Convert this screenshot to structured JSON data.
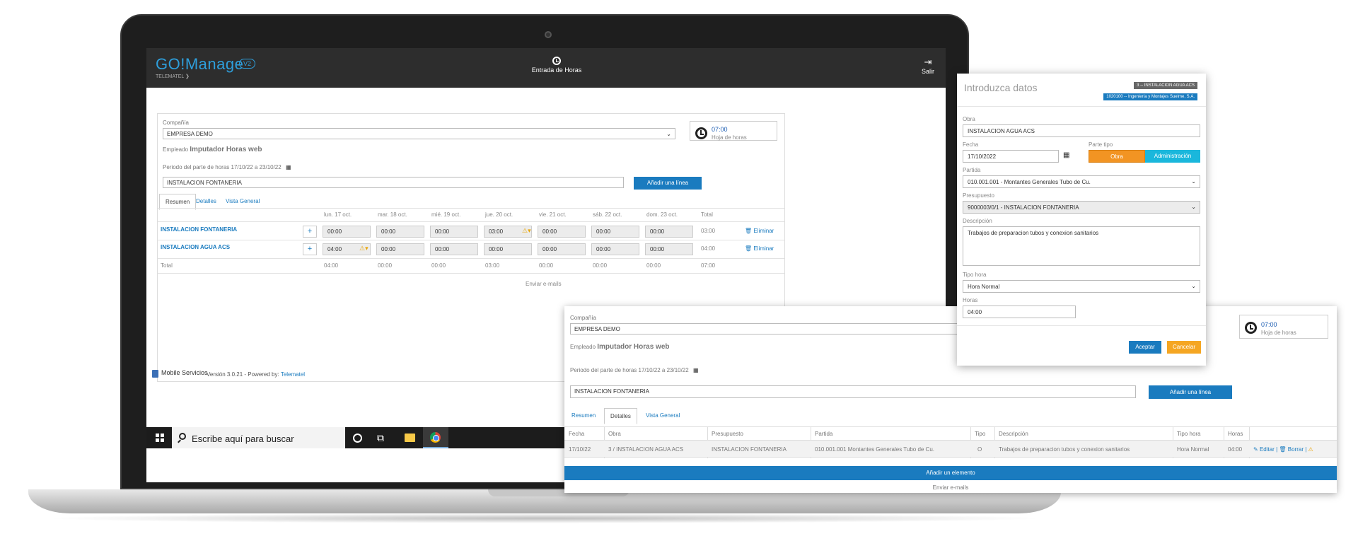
{
  "app": {
    "logo": "GO!Manage",
    "version_badge": "V2",
    "logo_sub": "TELEMATEL ❯",
    "header_center": "Entrada de Horas",
    "header_exit": "Salir"
  },
  "form": {
    "company_label": "Compañía",
    "company_value": "EMPRESA DEMO",
    "employee_label": "Empleado",
    "employee_value": "Imputador Horas web",
    "period_label": "Periodo del parte de horas",
    "period_value": "17/10/22 a 23/10/22",
    "work_value": "INSTALACION FONTANERIA",
    "add_line_button": "Añadir una línea",
    "clock_time": "07:00",
    "clock_label": "Hoja de horas"
  },
  "tabs": [
    "Resumen",
    "Detalles",
    "Vista General"
  ],
  "summary_table": {
    "headers": [
      "lun. 17 oct.",
      "mar. 18 oct.",
      "mié. 19 oct.",
      "jue. 20 oct.",
      "vie. 21 oct.",
      "sáb. 22 oct.",
      "dom. 23 oct.",
      "Total"
    ],
    "rows": [
      {
        "name": "INSTALACION FONTANERIA",
        "values": [
          "00:00",
          "00:00",
          "00:00",
          "03:00",
          "00:00",
          "00:00",
          "00:00"
        ],
        "total": "03:00",
        "delete": "Eliminar"
      },
      {
        "name": "INSTALACION AGUA ACS",
        "values": [
          "04:00",
          "00:00",
          "00:00",
          "00:00",
          "00:00",
          "00:00",
          "00:00"
        ],
        "total": "04:00",
        "delete": "Eliminar"
      }
    ],
    "total_label": "Total",
    "totals": [
      "04:00",
      "00:00",
      "00:00",
      "03:00",
      "00:00",
      "00:00",
      "00:00",
      "07:00"
    ],
    "send_emails": "Enviar e-mails"
  },
  "footer": {
    "brand": "Mobile Servicios",
    "version": "Versión 3.0.21 - Powered by:",
    "powered": "Telematel"
  },
  "taskbar": {
    "search_placeholder": "Escribe aquí para buscar"
  },
  "detail_table": {
    "headers": [
      "Fecha",
      "Obra",
      "Presupuesto",
      "Partida",
      "Tipo",
      "Descripción",
      "Tipo hora",
      "Horas"
    ],
    "row": [
      "17/10/22",
      "3 / INSTALACION AGUA ACS",
      "INSTALACION FONTANERIA",
      "010.001.001 Montantes Generales Tubo de Cu.",
      "O",
      "Trabajos de preparacion tubos y conexion sanitarios",
      "Hora Normal",
      "04:00"
    ],
    "edit": "Editar",
    "delete": "Borrar",
    "add_element": "Añadir un elemento",
    "send_emails": "Enviar e-mails"
  },
  "modal": {
    "title": "Introduzca datos",
    "badge_obra": "3 -- INSTALACION AGUA ACS",
    "badge_client": "1020100 -- Ingeniería y Montajes Suelme, S.A.",
    "obra_label": "Obra",
    "obra_value": "INSTALACION AGUA ACS",
    "fecha_label": "Fecha",
    "fecha_value": "17/10/2022",
    "parte_tipo_label": "Parte tipo",
    "parte_tipo_obra": "Obra",
    "parte_tipo_admin": "Administración",
    "partida_label": "Partida",
    "partida_value": "010.001.001 - Montantes Generales Tubo de Cu.",
    "presupuesto_label": "Presupuesto",
    "presupuesto_value": "9000003/0/1 - INSTALACION FONTANERIA",
    "descripcion_label": "Descripción",
    "descripcion_value": "Trabajos de preparacion tubos y conexion sanitarios",
    "tipo_hora_label": "Tipo hora",
    "tipo_hora_value": "Hora Normal",
    "horas_label": "Horas",
    "horas_value": "04:00",
    "accept": "Aceptar",
    "cancel": "Cancelar"
  },
  "colors": {
    "accent": "#1a7bbf",
    "orange": "#f5a623",
    "cyan": "#1ab7dc",
    "header_bg": "#2d2d2d"
  }
}
